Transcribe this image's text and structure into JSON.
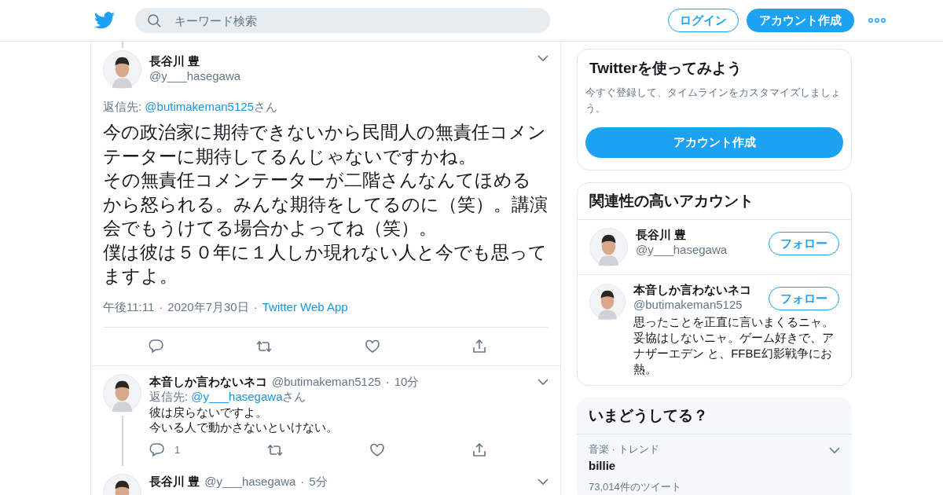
{
  "header": {
    "search_placeholder": "キーワード検索",
    "login_button": "ログイン",
    "signup_button": "アカウント作成"
  },
  "main_tweet": {
    "name": "長谷川 豊",
    "handle": "@y___hasegawa",
    "reply_label": "返信先:",
    "reply_to": "@butimakeman5125",
    "reply_suffix": "さん",
    "body": [
      "今の政治家に期待できないから民間人の無責任コメンテーターに期待してるんじゃないですかね。",
      "その無責任コメンテーターが二階さんなんてほめるから怒られる。みんな期待をしてるのに（笑）。講演会でもうけてる場合かよってね（笑）。",
      "僕は彼は５０年に１人しか現れない人と今でも思ってますよ。"
    ],
    "time": "午後11:11",
    "separator_1": "·",
    "date": "2020年7月30日",
    "separator_2": "·",
    "source": "Twitter Web App"
  },
  "replies": [
    {
      "name": "本音しか言わないネコ",
      "handle": "@butimakeman5125",
      "separator": "·",
      "age": "10分",
      "reply_label": "返信先:",
      "reply_to": "@y___hasegawa",
      "reply_suffix": "さん",
      "body": [
        "彼は戻らないですよ。",
        "今いる人で動かさないといけない。"
      ],
      "reply_count": "1"
    },
    {
      "name": "長谷川 豊",
      "handle": "@y___hasegawa",
      "separator": "·",
      "age": "5分"
    }
  ],
  "signup_card": {
    "title": "Twitterを使ってみよう",
    "text": "今すぐ登録して、タイムラインをカスタマイズしましょう。",
    "button": "アカウント作成"
  },
  "related": {
    "title": "関連性の高いアカウント",
    "accounts": [
      {
        "name": "長谷川 豊",
        "handle": "@y___hasegawa",
        "button": "フォロー"
      },
      {
        "name": "本音しか言わないネコ",
        "handle": "@butimakeman5125",
        "button": "フォロー",
        "bio": "思ったことを正直に言いまくるニャ。妥協はしないニャ。ゲーム好きで、アナザーエデン と、FFBE幻影戦争にお熱。"
      }
    ]
  },
  "trends": {
    "title": "いまどうしてる？",
    "items": [
      {
        "context": "音楽 · トレンド",
        "name": "billie",
        "count": "73,014件のツイート"
      }
    ]
  }
}
